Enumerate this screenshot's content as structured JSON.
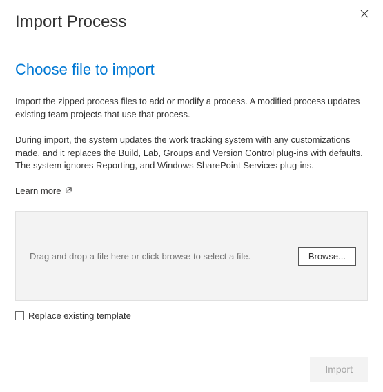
{
  "header": {
    "title": "Import Process"
  },
  "main": {
    "subtitle": "Choose file to import",
    "description1": "Import the zipped process files to add or modify a process. A modified process updates existing team projects that use that process.",
    "description2": "During import, the system updates the work tracking system with any customizations made, and it replaces the Build, Lab, Groups and Version Control plug-ins with defaults. The system ignores Reporting, and Windows SharePoint Services plug-ins.",
    "learn_more_label": "Learn more"
  },
  "drop_zone": {
    "prompt": "Drag and drop a file here or click browse to select a file.",
    "browse_label": "Browse..."
  },
  "options": {
    "replace_label": "Replace existing template"
  },
  "footer": {
    "import_label": "Import"
  }
}
